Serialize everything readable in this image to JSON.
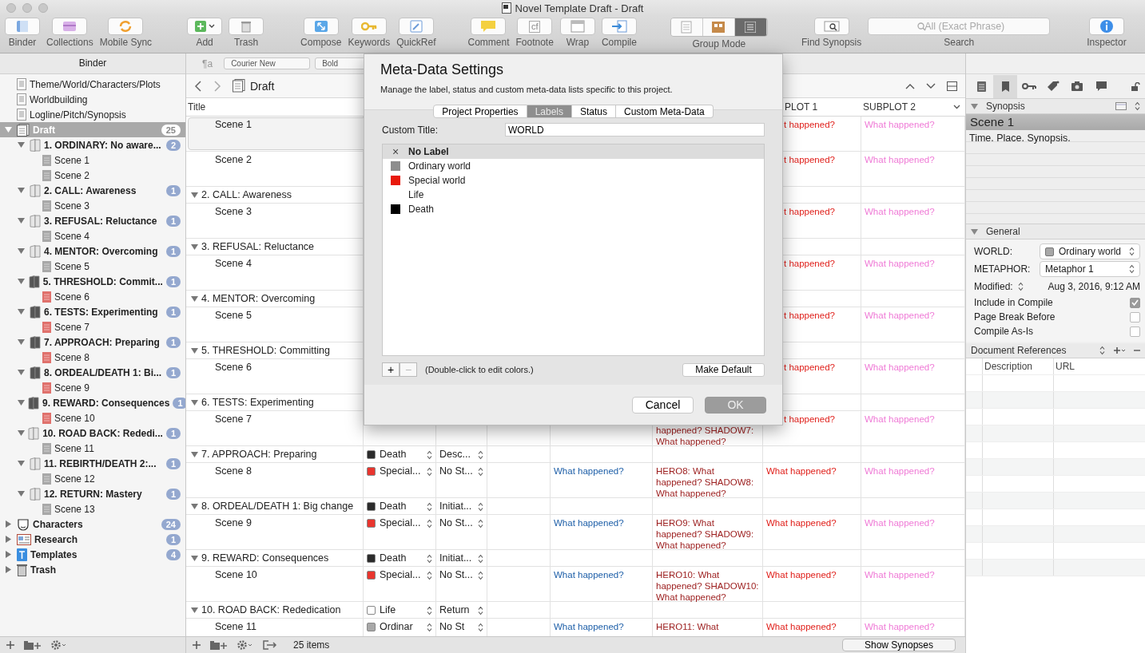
{
  "window": {
    "title": "Novel Template Draft - Draft"
  },
  "toolbar": {
    "groups": [
      [
        {
          "kind": "button",
          "label": "Binder"
        },
        {
          "kind": "button",
          "label": "Collections"
        },
        {
          "kind": "button",
          "label": "Mobile Sync"
        }
      ],
      [
        {
          "kind": "button",
          "label": "Add"
        },
        {
          "kind": "button",
          "label": "Trash"
        }
      ],
      [
        {
          "kind": "button",
          "label": "Compose"
        },
        {
          "kind": "button",
          "label": "Keywords"
        },
        {
          "kind": "button",
          "label": "QuickRef"
        }
      ],
      [
        {
          "kind": "button",
          "label": "Comment"
        },
        {
          "kind": "button",
          "label": "Footnote",
          "glyph": "cf"
        },
        {
          "kind": "button",
          "label": "Wrap"
        },
        {
          "kind": "button",
          "label": "Compile"
        }
      ],
      [
        {
          "kind": "segmented",
          "label": "Group Mode",
          "segments": [
            {
              "selected": false
            },
            {
              "selected": false
            },
            {
              "selected": true
            }
          ]
        }
      ],
      [
        {
          "kind": "button",
          "label": "Find Synopsis"
        }
      ],
      [
        {
          "kind": "search",
          "label": "Search",
          "placeholder": "All (Exact Phrase)"
        }
      ],
      [
        {
          "kind": "button",
          "label": "Inspector"
        }
      ]
    ]
  },
  "binder": {
    "header": "Binder",
    "items": [
      {
        "label": "Theme/World/Characters/Plots",
        "kind": "doc",
        "selected": false
      },
      {
        "label": "Worldbuilding",
        "kind": "doc",
        "selected": false
      },
      {
        "label": "Logline/Pitch/Synopsis",
        "kind": "doc",
        "selected": false
      },
      {
        "label": "Draft",
        "kind": "draft",
        "badge": "25",
        "expanded": true,
        "selected": true,
        "children": [
          {
            "label": "1. ORDINARY: No aware...",
            "kind": "folder",
            "color": "#e6e6e6",
            "badge": "2",
            "expanded": true,
            "selected": false,
            "children": [
              {
                "label": "Scene 1",
                "kind": "scene",
                "color": "#a8a8a8",
                "selected": false
              },
              {
                "label": "Scene 2",
                "kind": "scene",
                "color": "#a8a8a8",
                "selected": false
              }
            ]
          },
          {
            "label": "2. CALL: Awareness",
            "kind": "folder",
            "color": "#e6e6e6",
            "badge": "1",
            "expanded": true,
            "selected": false,
            "children": [
              {
                "label": "Scene 3",
                "kind": "scene",
                "color": "#a8a8a8",
                "selected": false
              }
            ]
          },
          {
            "label": "3. REFUSAL: Reluctance",
            "kind": "folder",
            "color": "#e6e6e6",
            "badge": "1",
            "expanded": true,
            "selected": false,
            "children": [
              {
                "label": "Scene 4",
                "kind": "scene",
                "color": "#a8a8a8",
                "selected": false
              }
            ]
          },
          {
            "label": "4. MENTOR: Overcoming",
            "kind": "folder",
            "color": "#e6e6e6",
            "badge": "1",
            "expanded": true,
            "selected": false,
            "children": [
              {
                "label": "Scene 5",
                "kind": "scene",
                "color": "#a8a8a8",
                "selected": false
              }
            ]
          },
          {
            "label": "5. THRESHOLD: Commit...",
            "kind": "folder",
            "color": "#555555",
            "badge": "1",
            "expanded": true,
            "selected": false,
            "children": [
              {
                "label": "Scene 6",
                "kind": "scene",
                "color": "#e0716c",
                "selected": false
              }
            ]
          },
          {
            "label": "6. TESTS: Experimenting",
            "kind": "folder",
            "color": "#555555",
            "badge": "1",
            "expanded": true,
            "selected": false,
            "children": [
              {
                "label": "Scene 7",
                "kind": "scene",
                "color": "#e0716c",
                "selected": false
              }
            ]
          },
          {
            "label": "7. APPROACH: Preparing",
            "kind": "folder",
            "color": "#555555",
            "badge": "1",
            "expanded": true,
            "selected": false,
            "children": [
              {
                "label": "Scene 8",
                "kind": "scene",
                "color": "#e0716c",
                "selected": false
              }
            ]
          },
          {
            "label": "8. ORDEAL/DEATH 1: Bi...",
            "kind": "folder",
            "color": "#555555",
            "badge": "1",
            "expanded": true,
            "selected": false,
            "children": [
              {
                "label": "Scene 9",
                "kind": "scene",
                "color": "#e0716c",
                "selected": false
              }
            ]
          },
          {
            "label": "9. REWARD: Consequences",
            "kind": "folder",
            "color": "#555555",
            "badge": "1",
            "expanded": true,
            "selected": false,
            "children": [
              {
                "label": "Scene 10",
                "kind": "scene",
                "color": "#e0716c",
                "selected": false
              }
            ]
          },
          {
            "label": "10. ROAD BACK: Rededi...",
            "kind": "folder",
            "color": "#e6e6e6",
            "badge": "1",
            "expanded": true,
            "selected": false,
            "children": [
              {
                "label": "Scene 11",
                "kind": "scene",
                "color": "#a8a8a8",
                "selected": false
              }
            ]
          },
          {
            "label": "11. REBIRTH/DEATH 2:...",
            "kind": "folder",
            "color": "#e6e6e6",
            "badge": "1",
            "expanded": true,
            "selected": false,
            "children": [
              {
                "label": "Scene 12",
                "kind": "scene",
                "color": "#a8a8a8",
                "selected": false
              }
            ]
          },
          {
            "label": "12. RETURN: Mastery",
            "kind": "folder",
            "color": "#e6e6e6",
            "badge": "1",
            "expanded": true,
            "selected": false,
            "children": [
              {
                "label": "Scene 13",
                "kind": "scene",
                "color": "#a8a8a8",
                "selected": false
              }
            ]
          }
        ]
      },
      {
        "label": "Characters",
        "kind": "characters",
        "badge": "24",
        "expanded": false,
        "selected": false
      },
      {
        "label": "Research",
        "kind": "research",
        "badge": "1",
        "expanded": false,
        "selected": false
      },
      {
        "label": "Templates",
        "kind": "templates",
        "badge": "4",
        "expanded": false,
        "selected": false
      },
      {
        "label": "Trash",
        "kind": "trash",
        "expanded": false,
        "selected": false
      }
    ]
  },
  "format_bar": {
    "style_glyph": "¶a",
    "font": "Courier New",
    "weight": "Bold"
  },
  "outline": {
    "title": "Draft",
    "header": {
      "title": "Title",
      "column_7": "PLOT 1",
      "column_8": "SUBPLOT 2"
    },
    "rows": [
      {
        "kind": "scene",
        "title": "Scene 1",
        "selected": true,
        "subplot_1": "t happened?",
        "subplot_2": "What happened?"
      },
      {
        "kind": "scene",
        "title": "Scene 2",
        "selected": false,
        "subplot_1": "t happened?",
        "subplot_2": "What happened?"
      },
      {
        "kind": "chapter",
        "title": "2. CALL: Awareness",
        "expanded": true,
        "selected": false
      },
      {
        "kind": "scene",
        "title": "Scene 3",
        "selected": false,
        "subplot_1": "t happened?",
        "subplot_2": "What happened?"
      },
      {
        "kind": "chapter",
        "title": "3. REFUSAL: Reluctance",
        "expanded": true,
        "selected": false
      },
      {
        "kind": "scene",
        "title": "Scene 4",
        "selected": false,
        "subplot_1": "t happened?",
        "subplot_2": "What happened?"
      },
      {
        "kind": "chapter",
        "title": "4. MENTOR: Overcoming",
        "expanded": true,
        "selected": false
      },
      {
        "kind": "scene",
        "title": "Scene 5",
        "selected": false,
        "subplot_1": "t happened?",
        "subplot_2": "What happened?"
      },
      {
        "kind": "chapter",
        "title": "5. THRESHOLD: Committing",
        "expanded": true,
        "selected": false
      },
      {
        "kind": "scene",
        "title": "Scene 6",
        "selected": false,
        "subplot_1": "t happened?",
        "subplot_2": "What happened?"
      },
      {
        "kind": "chapter",
        "title": "6. TESTS: Experimenting",
        "expanded": true,
        "selected": false
      },
      {
        "kind": "scene",
        "title": "Scene 7",
        "selected": false,
        "hero": "happened? SHADOW7: What happened?",
        "subplot_1": "t happened?",
        "subplot_2": "What happened?"
      },
      {
        "kind": "chapter",
        "title": "7. APPROACH: Preparing",
        "expanded": true,
        "selected": false,
        "label": {
          "text": "Death",
          "color": "#2b2b2b"
        },
        "status": "Desc..."
      },
      {
        "kind": "scene",
        "title": "Scene 8",
        "selected": false,
        "label": {
          "text": "Special...",
          "color": "#e8352e"
        },
        "status": "No St...",
        "column_5": "What happened?",
        "hero": "HERO8: What happened? SHADOW8: What happened?",
        "subplot_1": "What happened?",
        "subplot_2": "What happened?"
      },
      {
        "kind": "chapter",
        "title": "8. ORDEAL/DEATH 1: Big change",
        "expanded": true,
        "selected": false,
        "label": {
          "text": "Death",
          "color": "#2b2b2b"
        },
        "status": "Initiat..."
      },
      {
        "kind": "scene",
        "title": "Scene 9",
        "selected": false,
        "label": {
          "text": "Special...",
          "color": "#e8352e"
        },
        "status": "No St...",
        "column_5": "What happened?",
        "hero": "HERO9: What happened? SHADOW9: What happened?",
        "subplot_1": "What happened?",
        "subplot_2": "What happened?"
      },
      {
        "kind": "chapter",
        "title": "9. REWARD: Consequences",
        "expanded": true,
        "selected": false,
        "label": {
          "text": "Death",
          "color": "#2b2b2b"
        },
        "status": "Initiat..."
      },
      {
        "kind": "scene",
        "title": "Scene 10",
        "selected": false,
        "label": {
          "text": "Special...",
          "color": "#e8352e"
        },
        "status": "No St...",
        "column_5": "What happened?",
        "hero": "HERO10: What happened? SHADOW10: What happened?",
        "subplot_1": "What happened?",
        "subplot_2": "What happened?"
      },
      {
        "kind": "chapter",
        "title": "10. ROAD BACK: Rededication",
        "expanded": true,
        "selected": false,
        "label": {
          "text": "Life",
          "color": "#ffffff"
        },
        "status": "Return"
      },
      {
        "kind": "scene",
        "title": "Scene 11",
        "selected": false,
        "label": {
          "text": "Ordinar",
          "color": "#a8a8a8"
        },
        "status": "No St",
        "column_5": "What happened?",
        "hero": "HERO11: What",
        "subplot_1": "What happened?",
        "subplot_2": "What happened?"
      }
    ],
    "count": "25 items",
    "show_synopses": "Show Synopses"
  },
  "inspector": {
    "tabs": [
      {
        "kind": "notes",
        "selected": false
      },
      {
        "kind": "bookmark",
        "selected": true
      },
      {
        "kind": "key",
        "selected": false
      },
      {
        "kind": "tag",
        "selected": false
      },
      {
        "kind": "camera",
        "selected": false
      },
      {
        "kind": "comment",
        "selected": false
      }
    ],
    "synopsis_header": "Synopsis",
    "synopsis_title": "Scene 1",
    "synopsis_text": "Time. Place. Synopsis.",
    "general_header": "General",
    "fields": [
      {
        "kind": "select",
        "label": "WORLD:",
        "value": "Ordinary world",
        "color": "#a8a8a8"
      },
      {
        "kind": "select",
        "label": "METAPHOR:",
        "value": "Metaphor 1"
      },
      {
        "kind": "date",
        "label": "Modified:",
        "value": "Aug 3, 2016, 9:12 AM"
      },
      {
        "kind": "checkbox",
        "label": "Include in Compile",
        "checked": true
      },
      {
        "kind": "checkbox",
        "label": "Page Break Before",
        "checked": false
      },
      {
        "kind": "checkbox",
        "label": "Compile As-Is",
        "checked": false
      }
    ],
    "references_header": "Document References",
    "reference_columns": [
      "Description",
      "URL"
    ]
  },
  "dialog": {
    "title": "Meta-Data Settings",
    "description": "Manage the label, status and custom meta-data lists specific to this project.",
    "tabs": [
      {
        "label": "Project Properties",
        "selected": false
      },
      {
        "label": "Labels",
        "selected": true
      },
      {
        "label": "Status",
        "selected": false
      },
      {
        "label": "Custom Meta-Data",
        "selected": false
      }
    ],
    "custom_title_label": "Custom Title:",
    "custom_title": "WORLD",
    "labels": [
      {
        "kind": "none",
        "text": "No Label",
        "selected": true,
        "mark": "×"
      },
      {
        "kind": "color",
        "text": "Ordinary world",
        "color": "#8e8e8e",
        "selected": false
      },
      {
        "kind": "color",
        "text": "Special world",
        "color": "#e8190b",
        "selected": false
      },
      {
        "kind": "plain",
        "text": "Life",
        "selected": false
      },
      {
        "kind": "color",
        "text": "Death",
        "color": "#000000",
        "selected": false
      }
    ],
    "add": "+",
    "remove": "−",
    "hint": "(Double-click to edit colors.)",
    "make_default": "Make Default",
    "cancel": "Cancel",
    "ok": "OK"
  }
}
